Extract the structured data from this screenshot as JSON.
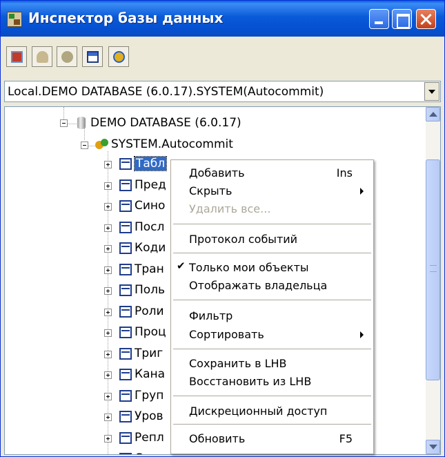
{
  "window": {
    "title": "Инспектор базы данных"
  },
  "toolbar": {
    "buttons": [
      {
        "icon": "add-object-icon"
      },
      {
        "icon": "user-icon"
      },
      {
        "icon": "bell-icon"
      },
      {
        "icon": "window-icon"
      },
      {
        "icon": "refresh-globe-icon"
      }
    ]
  },
  "connection_combo": {
    "value": "Local.DEMO DATABASE (6.0.17).SYSTEM(Autocommit)"
  },
  "tree": {
    "database": "DEMO DATABASE (6.0.17)",
    "schema": "SYSTEM.Autocommit",
    "nodes": [
      {
        "label": "Табл",
        "selected": true
      },
      {
        "label": "Пред"
      },
      {
        "label": "Сино"
      },
      {
        "label": "Посл"
      },
      {
        "label": "Коди"
      },
      {
        "label": "Тран"
      },
      {
        "label": "Поль"
      },
      {
        "label": "Роли"
      },
      {
        "label": "Проц"
      },
      {
        "label": "Триг"
      },
      {
        "label": "Кана"
      },
      {
        "label": "Груп"
      },
      {
        "label": "Уров"
      },
      {
        "label": "Репл"
      },
      {
        "label": "Стан"
      }
    ]
  },
  "context_menu": {
    "items": [
      {
        "label": "Добавить",
        "shortcut": "Ins"
      },
      {
        "label": "Скрыть"
      },
      {
        "label": "Удалить все..."
      },
      {
        "label": "Протокол событий"
      },
      {
        "label": "Только мои объекты"
      },
      {
        "label": "Отображать владельца"
      },
      {
        "label": "Фильтр"
      },
      {
        "label": "Сортировать"
      },
      {
        "label": "Сохранить в LHB"
      },
      {
        "label": "Восстановить из LHB"
      },
      {
        "label": "Дискреционный доступ"
      },
      {
        "label": "Обновить",
        "shortcut": "F5"
      }
    ]
  }
}
